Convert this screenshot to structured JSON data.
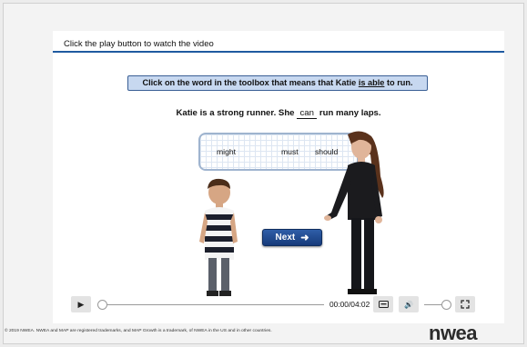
{
  "header": {
    "instruction": "Click the play button to watch the video"
  },
  "question": {
    "prefix": "Click on the word in the toolbox that means that Katie ",
    "emphasis": "is able",
    "suffix": " to run."
  },
  "sentence": {
    "before": "Katie is a strong runner. She ",
    "blank": "can",
    "after": " run many laps."
  },
  "toolbox": {
    "words": [
      "might",
      "must",
      "should"
    ]
  },
  "next_button": {
    "label": "Next"
  },
  "player": {
    "time": "00:00/04:02",
    "progress": 0,
    "volume": 0.85
  },
  "footer": {
    "legal": "© 2019 NWEA. NWEA and MAP are registered trademarks, and MAP Growth is a trademark, of NWEA in the US and in other countries.",
    "logo": "nwea"
  }
}
